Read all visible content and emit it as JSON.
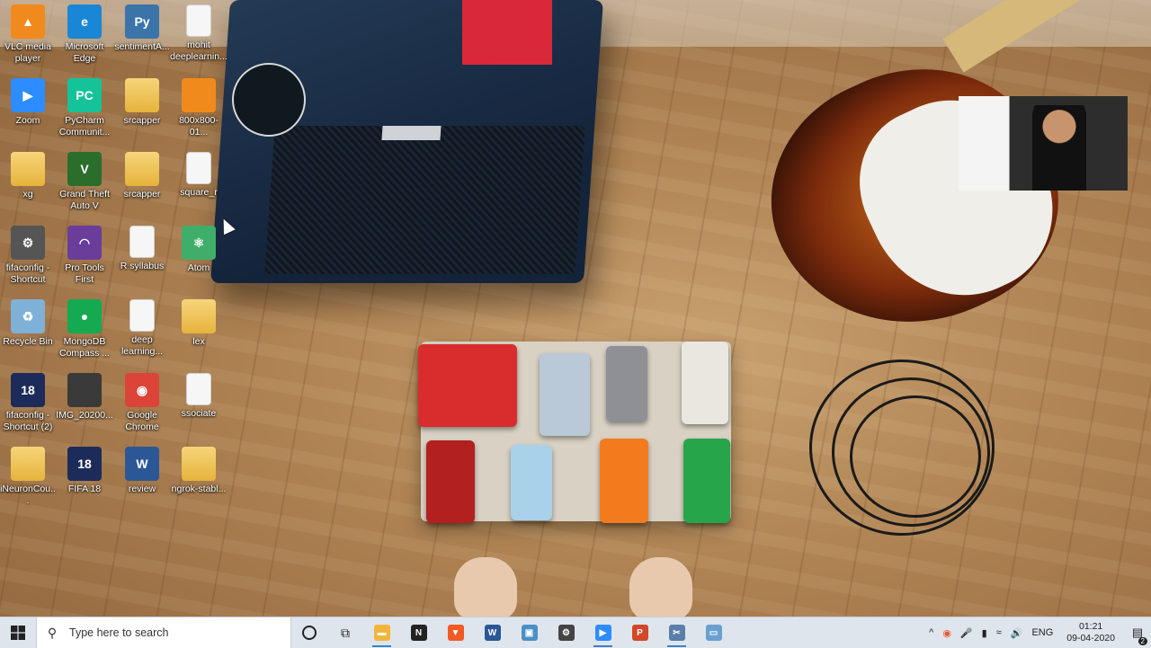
{
  "desktop": {
    "icons": [
      {
        "label": "VLC media player",
        "glyph": "▲",
        "color": "#f08a1c",
        "kind": "app"
      },
      {
        "label": "Microsoft Edge",
        "glyph": "e",
        "color": "#1a86d6",
        "kind": "app"
      },
      {
        "label": "sentimentA...",
        "glyph": "Py",
        "color": "#3a74a8",
        "kind": "file"
      },
      {
        "label": "mohit deeplearnin...",
        "glyph": "",
        "color": "#f6f6f6",
        "kind": "file"
      },
      {
        "label": "Zoom",
        "glyph": "▶",
        "color": "#2d8cff",
        "kind": "app"
      },
      {
        "label": "PyCharm Communit...",
        "glyph": "PC",
        "color": "#15c39a",
        "kind": "app"
      },
      {
        "label": "srcapper",
        "glyph": "",
        "color": "#e6b33c",
        "kind": "folder"
      },
      {
        "label": "800x800-01...",
        "glyph": "",
        "color": "#f08a1c",
        "kind": "image"
      },
      {
        "label": "xg",
        "glyph": "",
        "color": "#e6b33c",
        "kind": "folder"
      },
      {
        "label": "Grand Theft Auto V",
        "glyph": "V",
        "color": "#2b6e2b",
        "kind": "app"
      },
      {
        "label": "srcapper",
        "glyph": "",
        "color": "#e6b33c",
        "kind": "folder"
      },
      {
        "label": "square_r",
        "glyph": "",
        "color": "#f6f6f6",
        "kind": "file"
      },
      {
        "label": "fifaconfig - Shortcut",
        "glyph": "⚙",
        "color": "#555555",
        "kind": "app"
      },
      {
        "label": "Pro Tools First",
        "glyph": "◠",
        "color": "#6a3d9a",
        "kind": "app"
      },
      {
        "label": "R syllabus",
        "glyph": "",
        "color": "#f6f6f6",
        "kind": "file"
      },
      {
        "label": "Atom",
        "glyph": "⚛",
        "color": "#3fae6a",
        "kind": "app"
      },
      {
        "label": "Recycle Bin",
        "glyph": "♻",
        "color": "#7fb0d8",
        "kind": "app"
      },
      {
        "label": "MongoDB Compass ...",
        "glyph": "●",
        "color": "#13aa52",
        "kind": "app"
      },
      {
        "label": "deep learning...",
        "glyph": "",
        "color": "#f6f6f6",
        "kind": "file"
      },
      {
        "label": "lex",
        "glyph": "",
        "color": "#1c1c1c",
        "kind": "folder"
      },
      {
        "label": "fifaconfig - Shortcut (2)",
        "glyph": "18",
        "color": "#1d2b5a",
        "kind": "app"
      },
      {
        "label": "IMG_20200...",
        "glyph": "",
        "color": "#3a3a3a",
        "kind": "image"
      },
      {
        "label": "Google Chrome",
        "glyph": "◉",
        "color": "#db4437",
        "kind": "app"
      },
      {
        "label": "ssociate",
        "glyph": "",
        "color": "#f3efe8",
        "kind": "file"
      },
      {
        "label": "iNeuronCou...",
        "glyph": "",
        "color": "#e6b33c",
        "kind": "folder"
      },
      {
        "label": "FIFA 18",
        "glyph": "18",
        "color": "#1d2b5a",
        "kind": "app"
      },
      {
        "label": "review",
        "glyph": "W",
        "color": "#2b5797",
        "kind": "file"
      },
      {
        "label": "ngrok-stabl...",
        "glyph": "",
        "color": "#e6b33c",
        "kind": "folder"
      }
    ]
  },
  "taskbar": {
    "search_placeholder": "Type here to search",
    "start_icon": "windows-logo-icon",
    "apps": [
      {
        "name": "file-explorer",
        "glyph": "▬",
        "color": "#f2b53a",
        "running": true
      },
      {
        "name": "notion",
        "glyph": "N",
        "color": "#222222",
        "running": false
      },
      {
        "name": "brave",
        "glyph": "▼",
        "color": "#f15a24",
        "running": false
      },
      {
        "name": "word",
        "glyph": "W",
        "color": "#2b5797",
        "running": false
      },
      {
        "name": "photos",
        "glyph": "▣",
        "color": "#4a90c8",
        "running": false
      },
      {
        "name": "settings",
        "glyph": "⚙",
        "color": "#444444",
        "running": false
      },
      {
        "name": "zoom",
        "glyph": "▶",
        "color": "#2d8cff",
        "running": true
      },
      {
        "name": "powerpoint",
        "glyph": "P",
        "color": "#d24726",
        "running": false
      },
      {
        "name": "snipping-tool",
        "glyph": "✂",
        "color": "#5a7fa8",
        "running": true
      },
      {
        "name": "generic-window",
        "glyph": "▭",
        "color": "#6aa0d0",
        "running": false
      }
    ],
    "tray": {
      "language": "ENG",
      "time": "01:21",
      "date": "09-04-2020",
      "notification_count": "2"
    }
  }
}
